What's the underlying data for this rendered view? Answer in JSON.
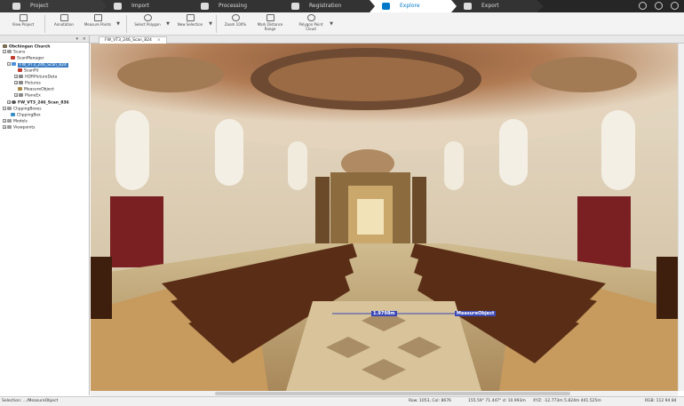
{
  "tabs": [
    "Project",
    "Import",
    "Processing",
    "Registration",
    "Explore",
    "Export"
  ],
  "ribbon": {
    "items": [
      "View Project",
      "Annotation",
      "Measure Points",
      "Select Polygon",
      "New Selection",
      "Zoom 100%",
      "Mark Distance Range",
      "Polygon Point Cloud"
    ]
  },
  "left_panel": {
    "header": "",
    "tree": [
      {
        "label": "Obchingen Church",
        "indent": 0
      },
      {
        "label": "Scans",
        "indent": 1
      },
      {
        "label": "ScanManager",
        "indent": 2
      },
      {
        "label": "FW_VT3_246_Scan_824",
        "indent": 2
      },
      {
        "label": "ScanFit",
        "indent": 3
      },
      {
        "label": "HDRPictureData",
        "indent": 3
      },
      {
        "label": "Pictures",
        "indent": 3
      },
      {
        "label": "MeasureObject",
        "indent": 3
      },
      {
        "label": "PlaneEx",
        "indent": 3
      },
      {
        "label": "FW_VT3_246_Scan_836",
        "indent": 2
      },
      {
        "label": "ClippingBoxes",
        "indent": 1
      },
      {
        "label": "ClippingBox",
        "indent": 2
      },
      {
        "label": "Models",
        "indent": 1
      },
      {
        "label": "Viewpoints",
        "indent": 1
      }
    ]
  },
  "view_tab": {
    "label": "FW_VT3_246_Scan_824",
    "close": "×"
  },
  "viewport": {
    "labels": [
      "1.9798m",
      "MeasureObject"
    ]
  },
  "status": {
    "selection": "Selection: .../MeasureObject",
    "rowcol": "Row: 1053, Col: 8676",
    "angles": "155.59° 71.447° d: 10.993m",
    "xyz": "XYZ: -12.773m 5.824m 441.525m",
    "rgb": "RGB: 112 94 84"
  }
}
